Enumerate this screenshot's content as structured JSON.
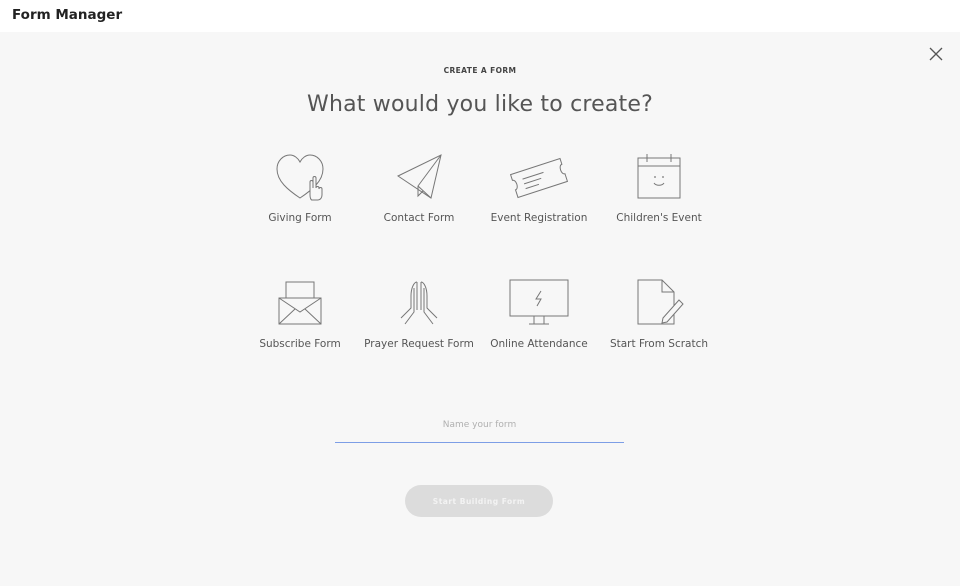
{
  "app": {
    "title": "Form Manager"
  },
  "dialog": {
    "eyebrow": "CREATE A FORM",
    "heading": "What would you like to create?",
    "close_icon": "close-icon"
  },
  "form_types": [
    {
      "label": "Giving Form",
      "icon": "heart-hand-icon"
    },
    {
      "label": "Contact Form",
      "icon": "paper-plane-icon"
    },
    {
      "label": "Event Registration",
      "icon": "ticket-icon"
    },
    {
      "label": "Children's Event",
      "icon": "calendar-smile-icon"
    },
    {
      "label": "Subscribe Form",
      "icon": "envelope-icon"
    },
    {
      "label": "Prayer Request Form",
      "icon": "praying-hands-icon"
    },
    {
      "label": "Online Attendance",
      "icon": "monitor-icon"
    },
    {
      "label": "Start From Scratch",
      "icon": "document-pencil-icon"
    }
  ],
  "name_field": {
    "placeholder": "Name your form",
    "value": ""
  },
  "start_button": {
    "label": "Start Building Form",
    "state": "disabled"
  }
}
